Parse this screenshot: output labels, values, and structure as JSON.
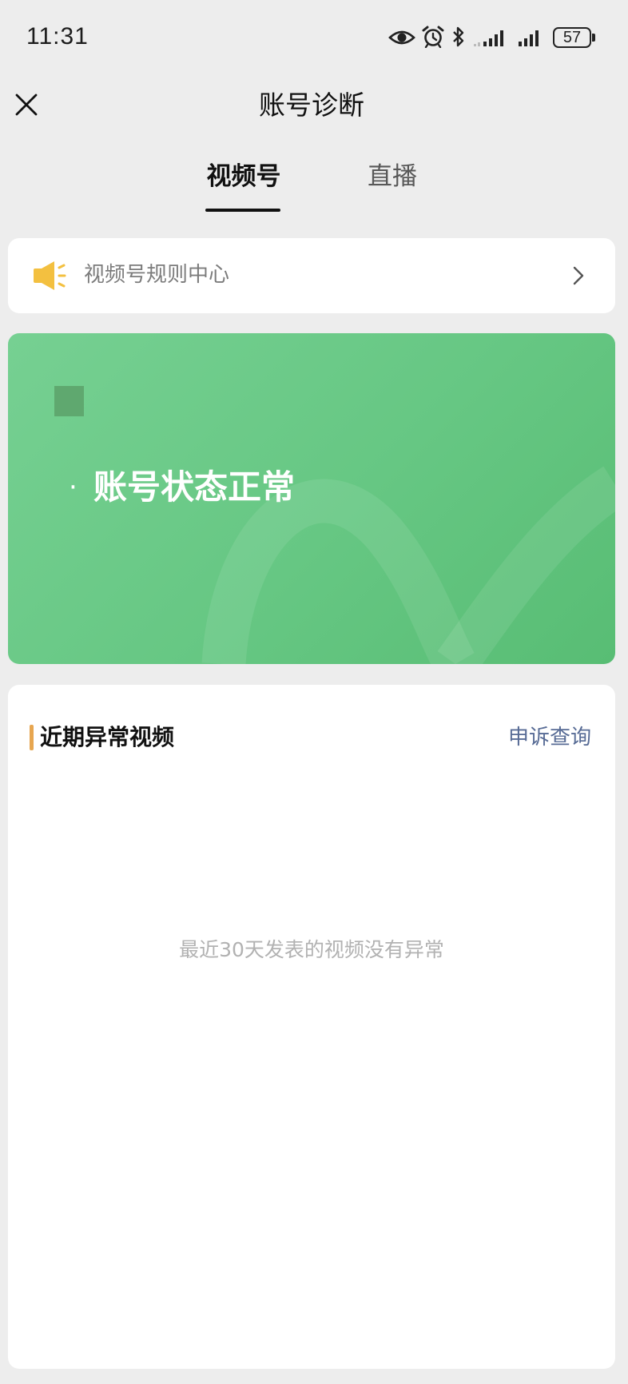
{
  "status_bar": {
    "time": "11:31",
    "battery": "57",
    "icons": [
      "eye-icon",
      "alarm-icon",
      "bluetooth-icon",
      "signal-icon",
      "signal-icon",
      "battery-icon"
    ]
  },
  "header": {
    "title": "账号诊断",
    "close_icon": "close-icon"
  },
  "tabs": [
    {
      "label": "视频号",
      "active": true
    },
    {
      "label": "直播",
      "active": false
    }
  ],
  "rules_entry": {
    "label": "视频号规则中心",
    "icon": "speaker-icon",
    "chevron": "chevron-right-icon"
  },
  "status_card": {
    "bullet": "·",
    "status_text": "账号状态正常"
  },
  "abnormal_section": {
    "title": "近期异常视频",
    "appeal_link": "申诉查询",
    "empty_message": "最近30天发表的视频没有异常"
  },
  "colors": {
    "page_bg": "#ededed",
    "card_bg": "#ffffff",
    "status_green_light": "#76d092",
    "status_green_dark": "#58bd74",
    "accent_bar": "#e7a650",
    "link": "#576b95",
    "speaker_icon": "#f3c040",
    "muted_text": "#b2b2b2"
  }
}
